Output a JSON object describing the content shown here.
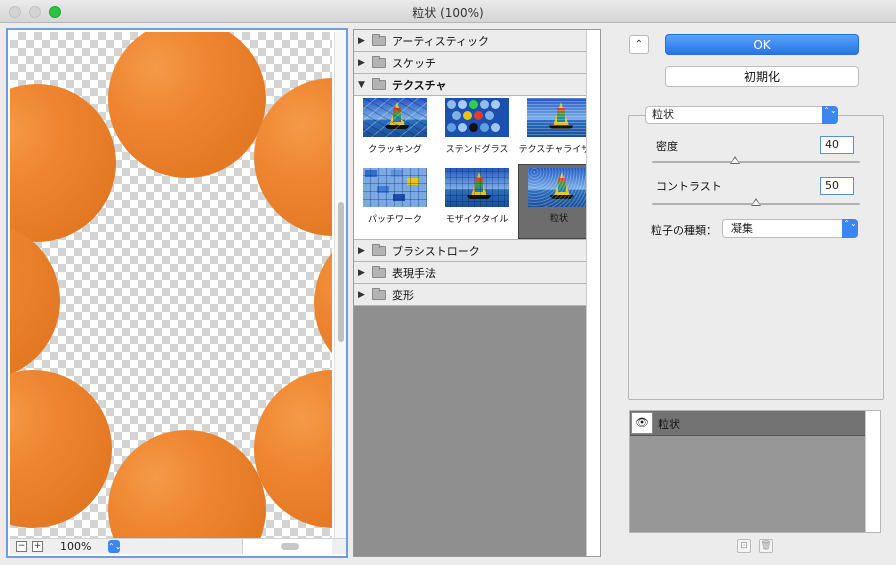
{
  "window": {
    "title": "粒状 (100%)"
  },
  "preview": {
    "zoom": "100%",
    "zoom_out": "−",
    "zoom_in": "+",
    "stepper": "⌃⌄"
  },
  "gallery": {
    "categories_top": [
      {
        "label": "アーティスティック",
        "expanded": false
      },
      {
        "label": "スケッチ",
        "expanded": false
      },
      {
        "label": "テクスチャ",
        "expanded": true
      }
    ],
    "texture_filters": [
      {
        "label": "クラッキング"
      },
      {
        "label": "ステンドグラス"
      },
      {
        "label": "テクスチャライザー"
      },
      {
        "label": "パッチワーク"
      },
      {
        "label": "モザイクタイル"
      },
      {
        "label": "粒状",
        "selected": true
      }
    ],
    "categories_bottom": [
      {
        "label": "ブラシストローク"
      },
      {
        "label": "表現手法"
      },
      {
        "label": "変形"
      }
    ],
    "collapsed_glyph": "▶",
    "expanded_glyph": "▼"
  },
  "buttons": {
    "ok": "OK",
    "defaults": "初期化",
    "collapse": "⌃"
  },
  "settings": {
    "filter_select": "粒状",
    "params": [
      {
        "label": "密度",
        "value": "40",
        "fraction": 0.4
      },
      {
        "label": "コントラスト",
        "value": "50",
        "fraction": 0.5
      }
    ],
    "grain_type_label": "粒子の種類：",
    "grain_type_value": "凝集",
    "select_arrow": "⌃⌄"
  },
  "layers": {
    "items": [
      {
        "name": "粒状",
        "visible_icon": "eye-icon"
      }
    ],
    "new_glyph": "⊡",
    "delete_glyph": "🗑"
  },
  "colors": {
    "accent": "#3d86f0",
    "circle_fill": "#ec8430",
    "preview_border": "#6e9ee0"
  }
}
